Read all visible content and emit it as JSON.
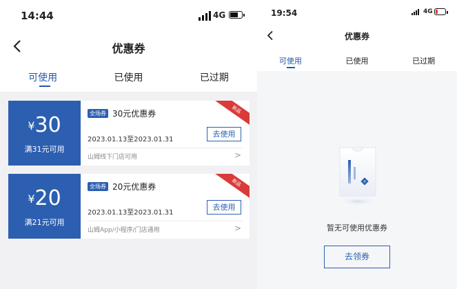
{
  "left": {
    "status": {
      "time": "14:44",
      "network": "4G"
    },
    "title": "优惠券",
    "tabs": [
      {
        "label": "可使用",
        "active": true
      },
      {
        "label": "已使用",
        "active": false
      },
      {
        "label": "已过期",
        "active": false
      }
    ],
    "coupons": [
      {
        "currency": "¥",
        "amount": "30",
        "condition": "满31元可用",
        "badge": "全场券",
        "name": "30元优惠券",
        "dates": "2023.01.13至2023.01.31",
        "button": "去使用",
        "scope": "山姆线下门店可用",
        "ribbon": "新品"
      },
      {
        "currency": "¥",
        "amount": "20",
        "condition": "满21元可用",
        "badge": "全场券",
        "name": "20元优惠券",
        "dates": "2023.01.13至2023.01.31",
        "button": "去使用",
        "scope": "山姆App/小程序/门店通用",
        "ribbon": "新品"
      }
    ]
  },
  "right": {
    "status": {
      "time": "19:54",
      "network": "4G"
    },
    "title": "优惠券",
    "tabs": [
      {
        "label": "可使用",
        "active": true
      },
      {
        "label": "已使用",
        "active": false
      },
      {
        "label": "已过期",
        "active": false
      }
    ],
    "empty_text": "暂无可使用优惠券",
    "claim_button": "去领券"
  },
  "colors": {
    "accent": "#2458a8",
    "coupon_blue": "#2c5fb0",
    "ribbon_red": "#d93b39",
    "battery_low": "#e53935"
  },
  "icons": [
    "signal-icon",
    "battery-icon",
    "back-arrow-icon",
    "chevron-right-icon",
    "empty-coupon-illustration"
  ]
}
